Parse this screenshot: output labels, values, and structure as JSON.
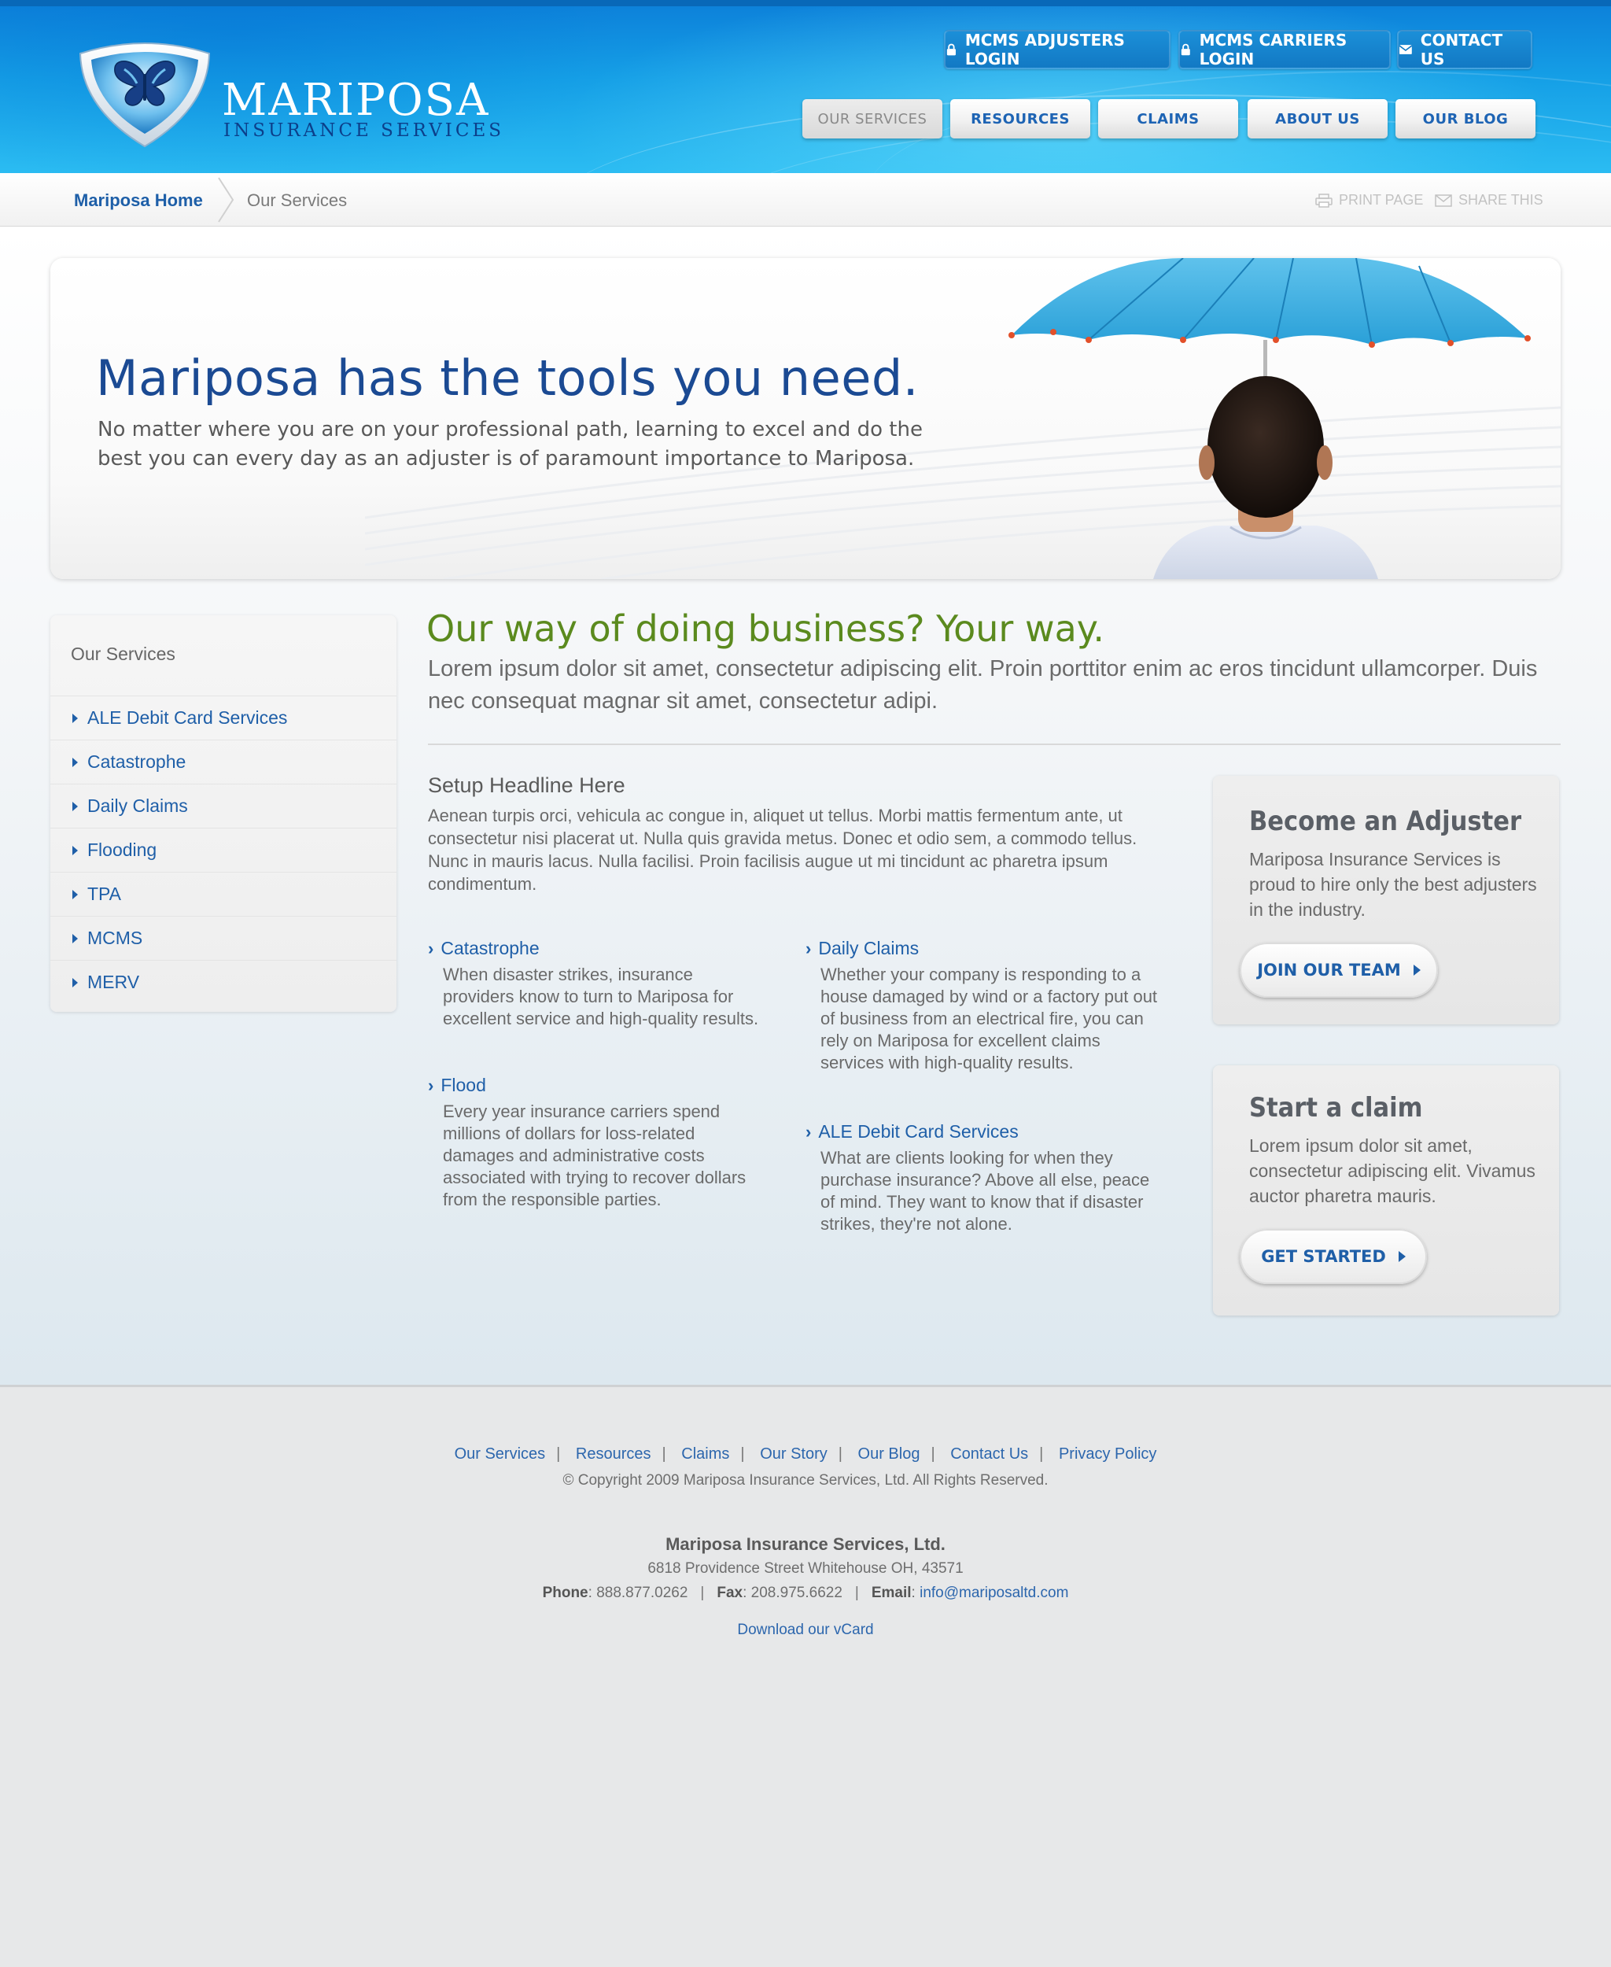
{
  "brand": {
    "name": "MARIPOSA",
    "tagline": "INSURANCE SERVICES",
    "accent": "#1f5fa8",
    "green": "#5b8a1e",
    "header_blue": "#159fe6"
  },
  "utility_nav": [
    {
      "label": "MCMS ADJUSTERS LOGIN",
      "icon": "lock-icon"
    },
    {
      "label": "MCMS CARRIERS LOGIN",
      "icon": "lock-icon"
    },
    {
      "label": "CONTACT US",
      "icon": "mail-icon"
    }
  ],
  "main_nav": [
    {
      "label": "OUR SERVICES",
      "active": true
    },
    {
      "label": "RESOURCES",
      "active": false
    },
    {
      "label": "CLAIMS",
      "active": false
    },
    {
      "label": "ABOUT US",
      "active": false
    },
    {
      "label": "OUR BLOG",
      "active": false
    }
  ],
  "breadcrumb": {
    "home": "Mariposa Home",
    "current": "Our Services",
    "print": "PRINT PAGE",
    "share": "SHARE THIS"
  },
  "hero": {
    "title": "Mariposa has the tools you need.",
    "text": "No matter where you are on your professional path, learning to excel and do the best you can every day as an adjuster is of paramount importance to Mariposa."
  },
  "sidebar": {
    "title": "Our Services",
    "items": [
      {
        "label": "ALE Debit Card Services"
      },
      {
        "label": "Catastrophe"
      },
      {
        "label": "Daily Claims"
      },
      {
        "label": "Flooding"
      },
      {
        "label": "TPA"
      },
      {
        "label": "MCMS"
      },
      {
        "label": "MERV"
      }
    ]
  },
  "content": {
    "heading": "Our way of doing business? Your way.",
    "intro": "Lorem ipsum dolor sit amet, consectetur adipiscing elit. Proin porttitor enim ac eros tincidunt ullamcorper. Duis nec consequat magnar sit amet, consectetur adipi.",
    "setup_heading": "Setup Headline Here",
    "setup_text": "Aenean turpis orci, vehicula ac congue in, aliquet ut tellus. Morbi mattis fermentum ante, ut consectetur nisi placerat ut. Nulla quis gravida metus. Donec et odio sem, a commodo tellus. Nunc in mauris lacus. Nulla facilisi. Proin facilisis augue ut mi tincidunt ac pharetra ipsum condimentum.",
    "services": [
      {
        "title": "Catastrophe",
        "text": "When disaster strikes, insurance providers know to turn to Mariposa for excellent service and high-quality results."
      },
      {
        "title": "Daily Claims",
        "text": "Whether your company is responding to a house damaged by wind or a factory put out of business from an electrical fire, you can rely on Mariposa for excellent claims services with high-quality results."
      },
      {
        "title": "Flood",
        "text": "Every year insurance carriers spend millions of dollars for loss-related damages and administrative costs associated with trying to recover dollars from the responsible parties."
      },
      {
        "title": "ALE Debit Card Services",
        "text": "What are clients looking for when they purchase insurance? Above all else, peace of mind. They want to know that if disaster strikes, they're not alone."
      }
    ]
  },
  "cta": [
    {
      "title": "Become an Adjuster",
      "text": "Mariposa Insurance Services is proud to hire only the best adjusters in the industry.",
      "button": "JOIN OUR TEAM"
    },
    {
      "title": "Start a claim",
      "text": "Lorem ipsum dolor sit amet, consectetur adipiscing elit. Vivamus auctor pharetra mauris.",
      "button": "GET STARTED"
    }
  ],
  "footer": {
    "links": [
      "Our Services",
      "Resources",
      "Claims",
      "Our Story",
      "Our Blog",
      "Contact Us",
      "Privacy Policy"
    ],
    "copyright": "© Copyright 2009 Mariposa Insurance Services, Ltd. All Rights Reserved.",
    "company": "Mariposa Insurance Services, Ltd.",
    "address": "6818 Providence Street Whitehouse OH, 43571",
    "phone_label": "Phone",
    "phone": "888.877.0262",
    "fax_label": "Fax",
    "fax": "208.975.6622",
    "email_label": "Email",
    "email": "info@mariposaltd.com",
    "vcard": "Download our vCard"
  }
}
